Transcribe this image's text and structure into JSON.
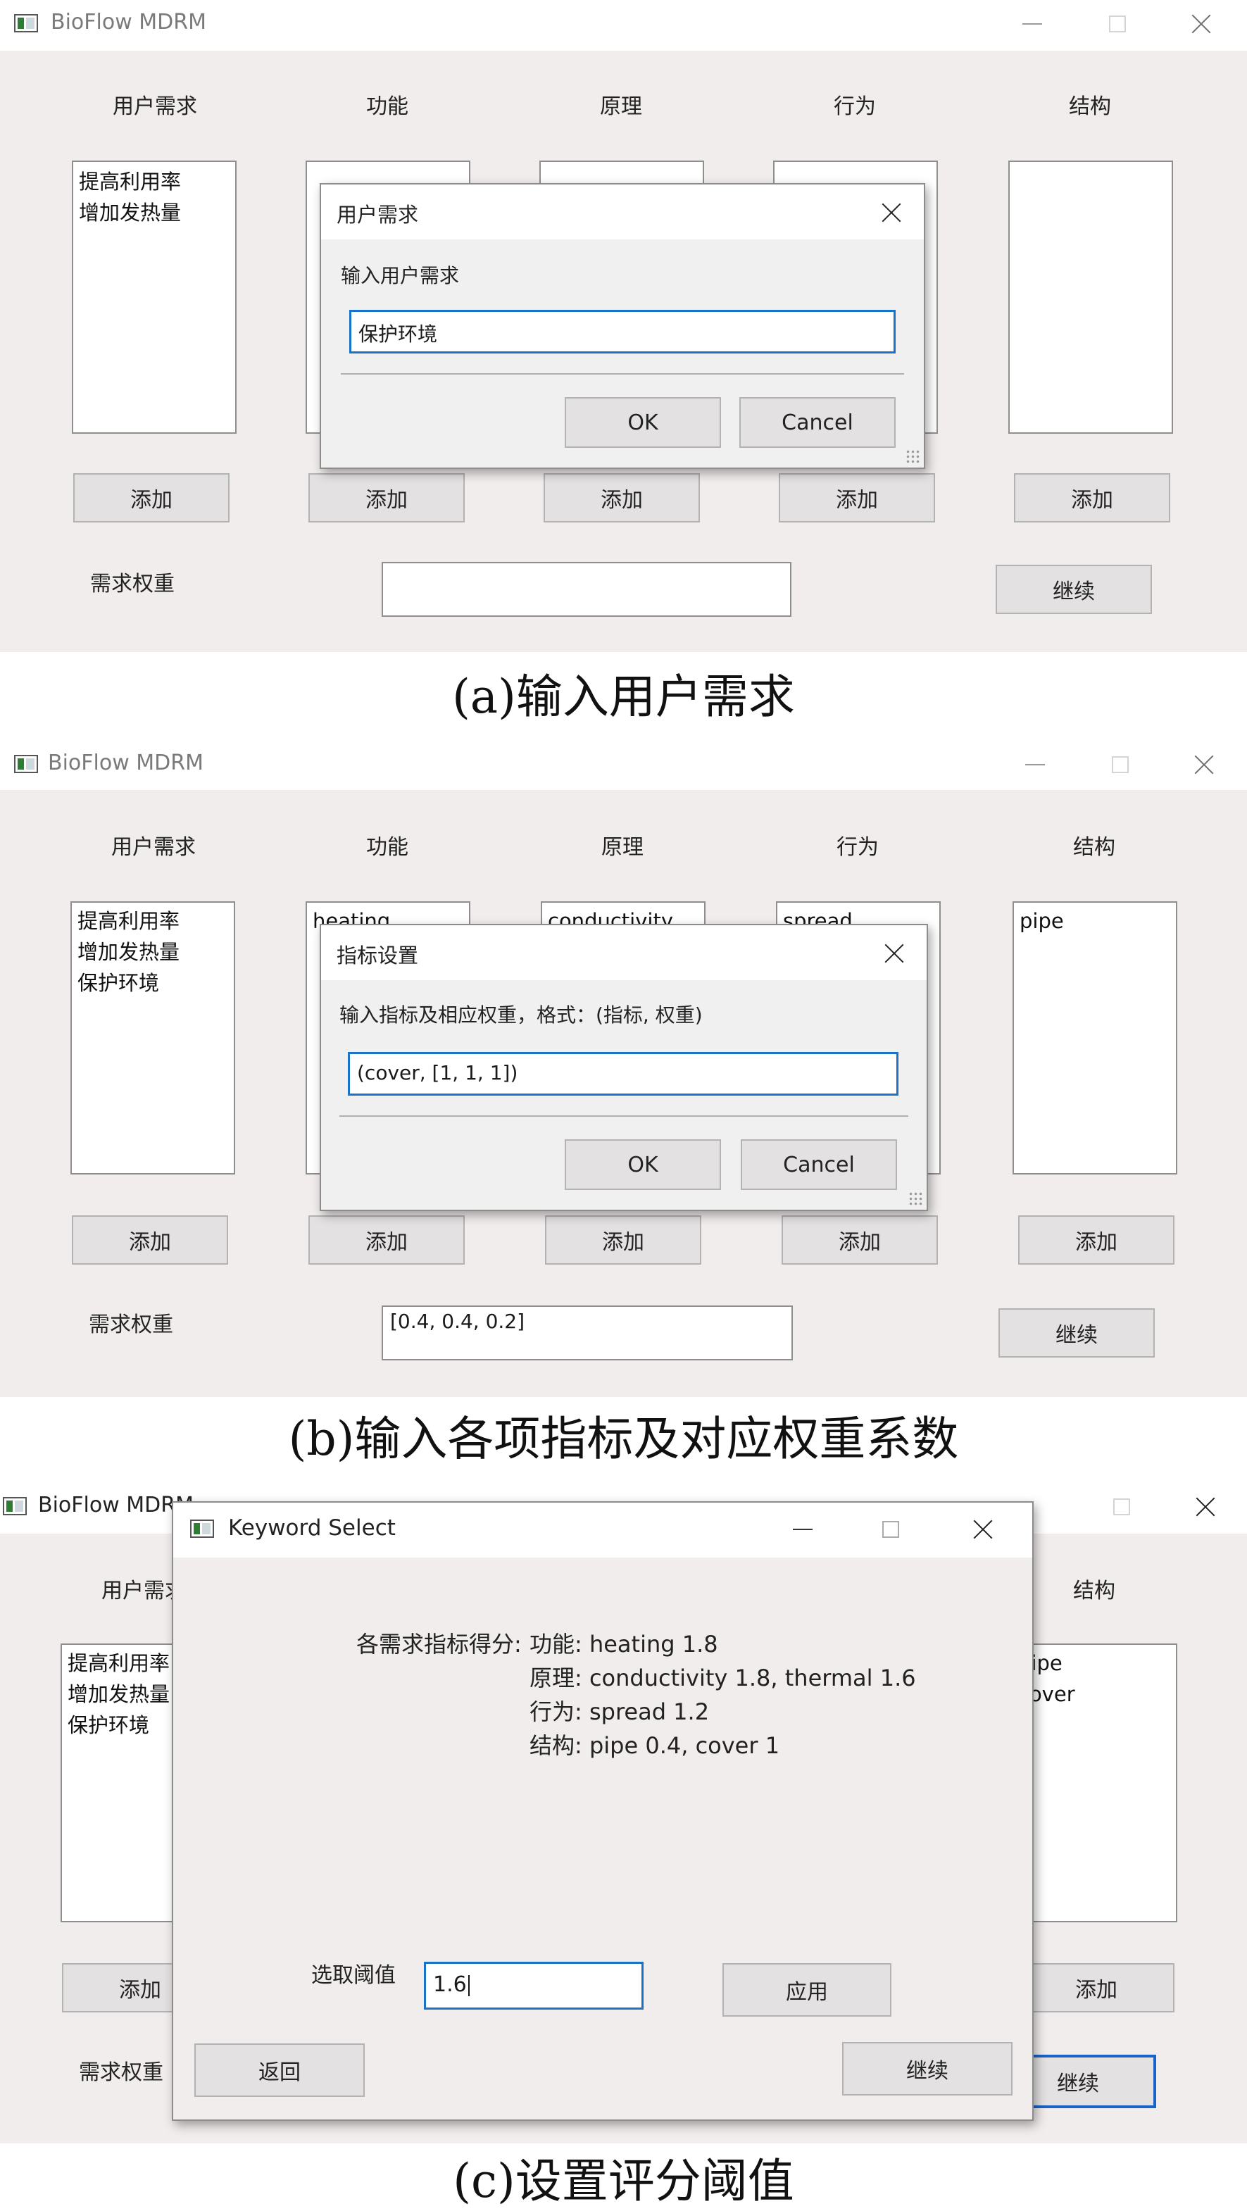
{
  "app_title": "BioFlow MDRM",
  "columns": [
    "用户需求",
    "功能",
    "原理",
    "行为",
    "结构"
  ],
  "add_label": "添加",
  "weight_label": "需求权重",
  "continue_label": "继续",
  "panel_a": {
    "caption": "(a)输入用户需求",
    "user_needs": [
      "提高利用率",
      "增加发热量"
    ],
    "dialog": {
      "title": "用户需求",
      "prompt": "输入用户需求",
      "value": "保护环境",
      "ok": "OK",
      "cancel": "Cancel"
    },
    "weight_value": ""
  },
  "panel_b": {
    "caption": "(b)输入各项指标及对应权重系数",
    "user_needs": [
      "提高利用率",
      "增加发热量",
      "保护环境"
    ],
    "function_items": [
      "heating"
    ],
    "principle_items": [
      "conductivity"
    ],
    "behavior_items": [
      "spread"
    ],
    "structure_items": [
      "pipe"
    ],
    "dialog": {
      "title": "指标设置",
      "prompt": "输入指标及相应权重，格式：(指标, 权重)",
      "value": "(cover, [1, 1, 1])",
      "ok": "OK",
      "cancel": "Cancel"
    },
    "weight_value": "[0.4, 0.4, 0.2]"
  },
  "panel_c": {
    "caption": "(c)设置评分阈值",
    "user_needs": [
      "提高利用率",
      "增加发热量",
      "保护环境"
    ],
    "structure_items": [
      "pipe",
      "cover"
    ],
    "bg_header_partial": "用户需求",
    "dialog": {
      "title": "Keyword Select",
      "score_label": "各需求指标得分:",
      "scores": [
        "功能: heating 1.8",
        "原理: conductivity 1.8, thermal 1.6",
        "行为: spread 1.2",
        "结构: pipe 0.4, cover 1"
      ],
      "threshold_label": "选取阈值",
      "threshold_value": "1.6",
      "apply": "应用",
      "back": "返回",
      "continue": "继续"
    }
  },
  "colors": {
    "window_bg": "#f1edec",
    "focus_blue": "#1a73c6"
  }
}
